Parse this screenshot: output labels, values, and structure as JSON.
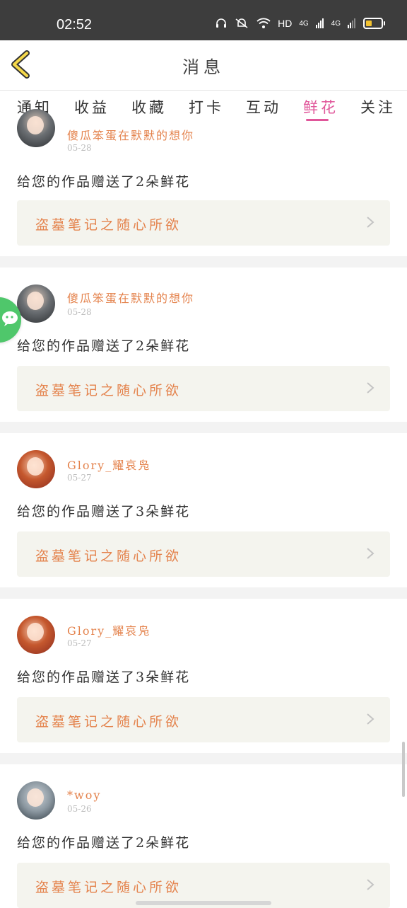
{
  "status_bar": {
    "time": "02:52",
    "icons": [
      "headset-icon",
      "silent-bell-icon",
      "wifi-icon",
      "HD",
      "4G",
      "4G",
      "battery-icon"
    ],
    "hd_label": "HD",
    "net1": "4G",
    "net2": "4G"
  },
  "header": {
    "title": "消息"
  },
  "tabs": [
    {
      "label": "通知"
    },
    {
      "label": "收益"
    },
    {
      "label": "收藏"
    },
    {
      "label": "打卡"
    },
    {
      "label": "互动"
    },
    {
      "label": "鲜花",
      "active": true
    },
    {
      "label": "关注"
    }
  ],
  "colors": {
    "accent": "#e0569a",
    "username": "#e4834d",
    "box_bg": "#f4f4ee"
  },
  "feed": [
    {
      "username": "傻瓜笨蛋在默默的想你",
      "date": "05-28",
      "message": "给您的作品赠送了2朵鲜花",
      "work": "盗墓笔记之随心所欲"
    },
    {
      "username": "傻瓜笨蛋在默默的想你",
      "date": "05-28",
      "message": "给您的作品赠送了2朵鲜花",
      "work": "盗墓笔记之随心所欲"
    },
    {
      "username": "Glory_耀哀凫",
      "date": "05-27",
      "message": "给您的作品赠送了3朵鲜花",
      "work": "盗墓笔记之随心所欲"
    },
    {
      "username": "Glory_耀哀凫",
      "date": "05-27",
      "message": "给您的作品赠送了3朵鲜花",
      "work": "盗墓笔记之随心所欲"
    },
    {
      "username": "*woy",
      "date": "05-26",
      "message": "给您的作品赠送了2朵鲜花",
      "work": "盗墓笔记之随心所欲"
    }
  ]
}
